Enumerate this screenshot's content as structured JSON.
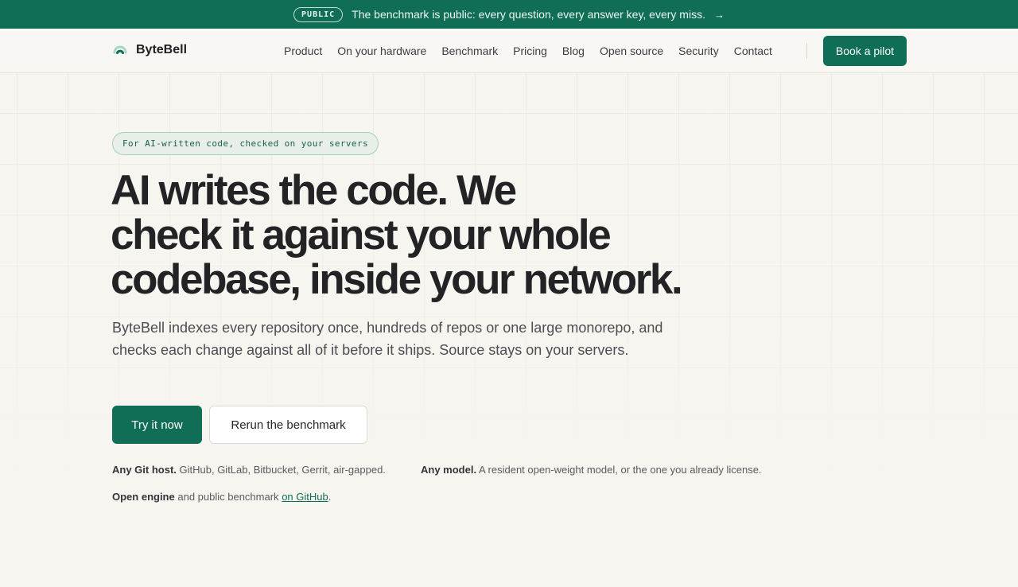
{
  "announcement": {
    "badge": "PUBLIC",
    "text": "The benchmark is public: every question, every answer key, every miss.",
    "arrow": "→"
  },
  "brand": {
    "name": "ByteBell",
    "logo_icon": "bytebell-logo-icon"
  },
  "nav": {
    "links": [
      "Product",
      "On your hardware",
      "Benchmark",
      "Pricing",
      "Blog",
      "Open source",
      "Security",
      "Contact"
    ],
    "cta": "Book a pilot"
  },
  "hero": {
    "eyebrow": "For AI-written code, checked on your servers",
    "headline_lines": [
      "AI writes the code. We",
      "check it against your whole",
      "codebase, inside your network."
    ],
    "lead": "ByteBell indexes every repository once, hundreds of repos or one large monorepo, and checks each change against all of it before it ships. Source stays on your servers.",
    "primary_cta": "Try it now",
    "secondary_cta": "Rerun the benchmark",
    "features": [
      {
        "title": "Any Git host.",
        "text": "GitHub, GitLab, Bitbucket, Gerrit, air-gapped."
      },
      {
        "title": "Any model.",
        "text": "A resident open-weight model, or the one you already license."
      },
      {
        "title": "Open engine",
        "text": "and public benchmark",
        "link": "on GitHub",
        "suffix": "."
      }
    ]
  },
  "colors": {
    "brand_green": "#0f6e55",
    "page_background": "#f6f5f0",
    "text_dark": "#232326"
  }
}
